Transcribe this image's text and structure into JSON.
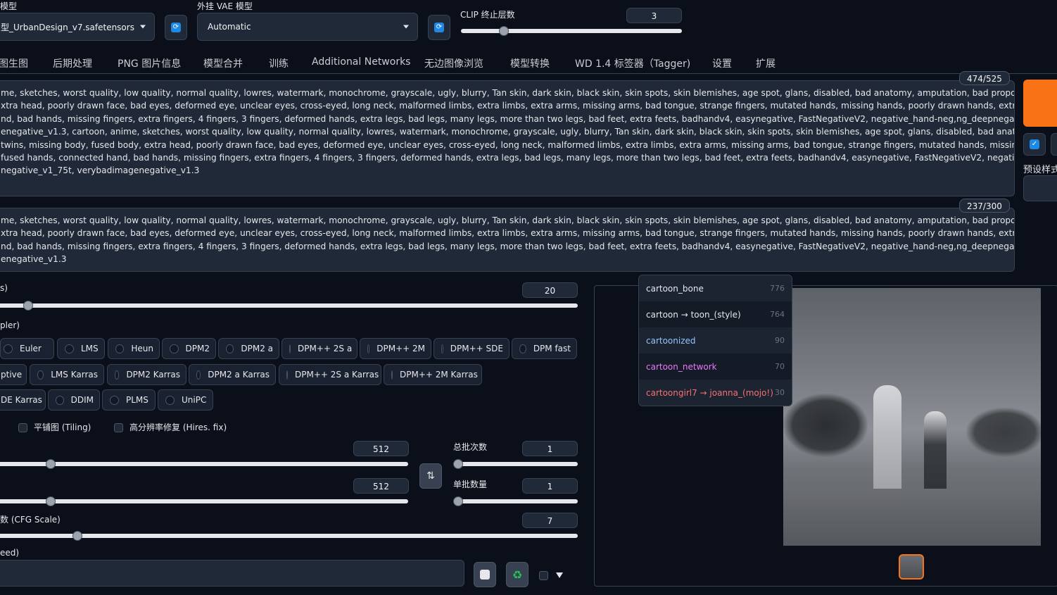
{
  "top": {
    "model_label": "模型",
    "model_value": "型_UrbanDesign_v7.safetensors",
    "vae_label": "外挂 VAE 模型",
    "vae_value": "Automatic",
    "clip_label": "CLIP 终止层数",
    "clip_value": "3"
  },
  "tabs": [
    {
      "label": "图生图"
    },
    {
      "label": "后期处理"
    },
    {
      "label": "PNG 图片信息"
    },
    {
      "label": "模型合并"
    },
    {
      "label": "训练"
    },
    {
      "label": "Additional Networks"
    },
    {
      "label": "无边图像浏览"
    },
    {
      "label": "模型转换"
    },
    {
      "label": "WD 1.4 标签器（Tagger)"
    },
    {
      "label": "设置"
    },
    {
      "label": "扩展"
    }
  ],
  "prompt1": {
    "counter": "474/525",
    "lines": [
      "me, sketches, worst quality, low quality, normal quality, lowres, watermark, monochrome, grayscale, ugly, blurry, Tan skin, dark skin, black skin, skin spots, skin blemishes, age spot, glans, disabled, bad anatomy, amputation, bad proportions, twins, missing body,",
      "xtra head, poorly drawn face, bad eyes, deformed eye, unclear eyes, cross-eyed, long neck, malformed limbs, extra limbs, extra arms, missing arms, bad tongue, strange fingers, mutated hands, missing hands, poorly drawn hands, extra hands, fused hands,",
      "nd, bad hands, missing fingers, extra fingers, 4 fingers, 3 fingers, deformed hands, extra legs, bad legs, many legs, more than two legs, bad feet, extra feets, badhandv4, easynegative, FastNegativeV2, negative_hand-neg,ng_deepnegative_v1_75t,",
      "enegative_v1.3, cartoon, anime, sketches, worst quality, low quality, normal quality, lowres, watermark, monochrome, grayscale, ugly, blurry, Tan skin, dark skin, black skin, skin spots, skin blemishes, age spot, glans, disabled, bad anatomy, amputation, bad",
      "twins, missing body, fused body, extra head, poorly drawn face, bad eyes, deformed eye, unclear eyes, cross-eyed, long neck, malformed limbs, extra limbs, extra arms, missing arms, bad tongue, strange fingers, mutated hands, missing hands, poorly drawn hands,",
      "fused hands, connected hand, bad hands, missing fingers, extra fingers, 4 fingers, 3 fingers, deformed hands, extra legs, bad legs, many legs, more than two legs, bad feet, extra feets, badhandv4, easynegative, FastNegativeV2, negative_hand-",
      "negative_v1_75t, verybadimagenegative_v1.3"
    ]
  },
  "prompt2": {
    "counter": "237/300",
    "lines": [
      "me, sketches, worst quality, low quality, normal quality, lowres, watermark, monochrome, grayscale, ugly, blurry, Tan skin, dark skin, black skin, skin spots, skin blemishes, age spot, glans, disabled, bad anatomy, amputation, bad proportions, twins, missing body,",
      "xtra head, poorly drawn face, bad eyes, deformed eye, unclear eyes, cross-eyed, long neck, malformed limbs, extra limbs, extra arms, missing arms, bad tongue, strange fingers, mutated hands, missing hands, poorly drawn hands, extra hands, fused hands,",
      "nd, bad hands, missing fingers, extra fingers, 4 fingers, 3 fingers, deformed hands, extra legs, bad legs, many legs, more than two legs, bad feet, extra feets, badhandv4, easynegative, FastNegativeV2, negative_hand-neg,ng_deepnegative_v1_75t,",
      "enegative_v1.3"
    ]
  },
  "right": {
    "preset_label": "预设样式"
  },
  "steps": {
    "label": "s)",
    "value": "20",
    "level": 0.2
  },
  "sampler": {
    "label": "pler)",
    "row1": [
      "Euler",
      "LMS",
      "Heun",
      "DPM2",
      "DPM2 a",
      "DPM++ 2S a",
      "DPM++ 2M",
      "DPM++ SDE",
      "DPM fast"
    ],
    "row2": [
      "ptive",
      "LMS Karras",
      "DPM2 Karras",
      "DPM2 a Karras",
      "DPM++ 2S a Karras",
      "DPM++ 2M Karras"
    ],
    "row3": [
      "DE Karras",
      "DDIM",
      "PLMS",
      "UniPC"
    ]
  },
  "options": {
    "tiling": "平铺图 (Tiling)",
    "hires": "高分辨率修复 (Hires. fix)"
  },
  "width": {
    "value": "512",
    "level": 0.25
  },
  "height": {
    "value": "512",
    "level": 0.25
  },
  "batch_count": {
    "label": "总批次数",
    "value": "1",
    "level": 0
  },
  "batch_size": {
    "label": "单批数量",
    "value": "1",
    "level": 0
  },
  "swap_icon": "⇅",
  "cfg": {
    "label": "数 (CFG Scale)",
    "value": "7",
    "level": 0.23
  },
  "seed": {
    "label": "eed)"
  },
  "autocomplete": [
    {
      "text": "cartoon_bone",
      "count": "776",
      "color": "#e5e7eb"
    },
    {
      "text": "cartoon → toon_(style)",
      "count": "764",
      "color": "#e5e7eb"
    },
    {
      "text": "cartoonized",
      "count": "90",
      "color": "#93c5fd"
    },
    {
      "text": "cartoon_network",
      "count": "70",
      "color": "#e879f9"
    },
    {
      "text": "cartoongirl7 → joanna_(mojo!)",
      "count": "30",
      "color": "#f87171"
    }
  ],
  "colors": {
    "accent": "#f97316",
    "bg": "#0b0f19",
    "panel": "#1f2937"
  }
}
